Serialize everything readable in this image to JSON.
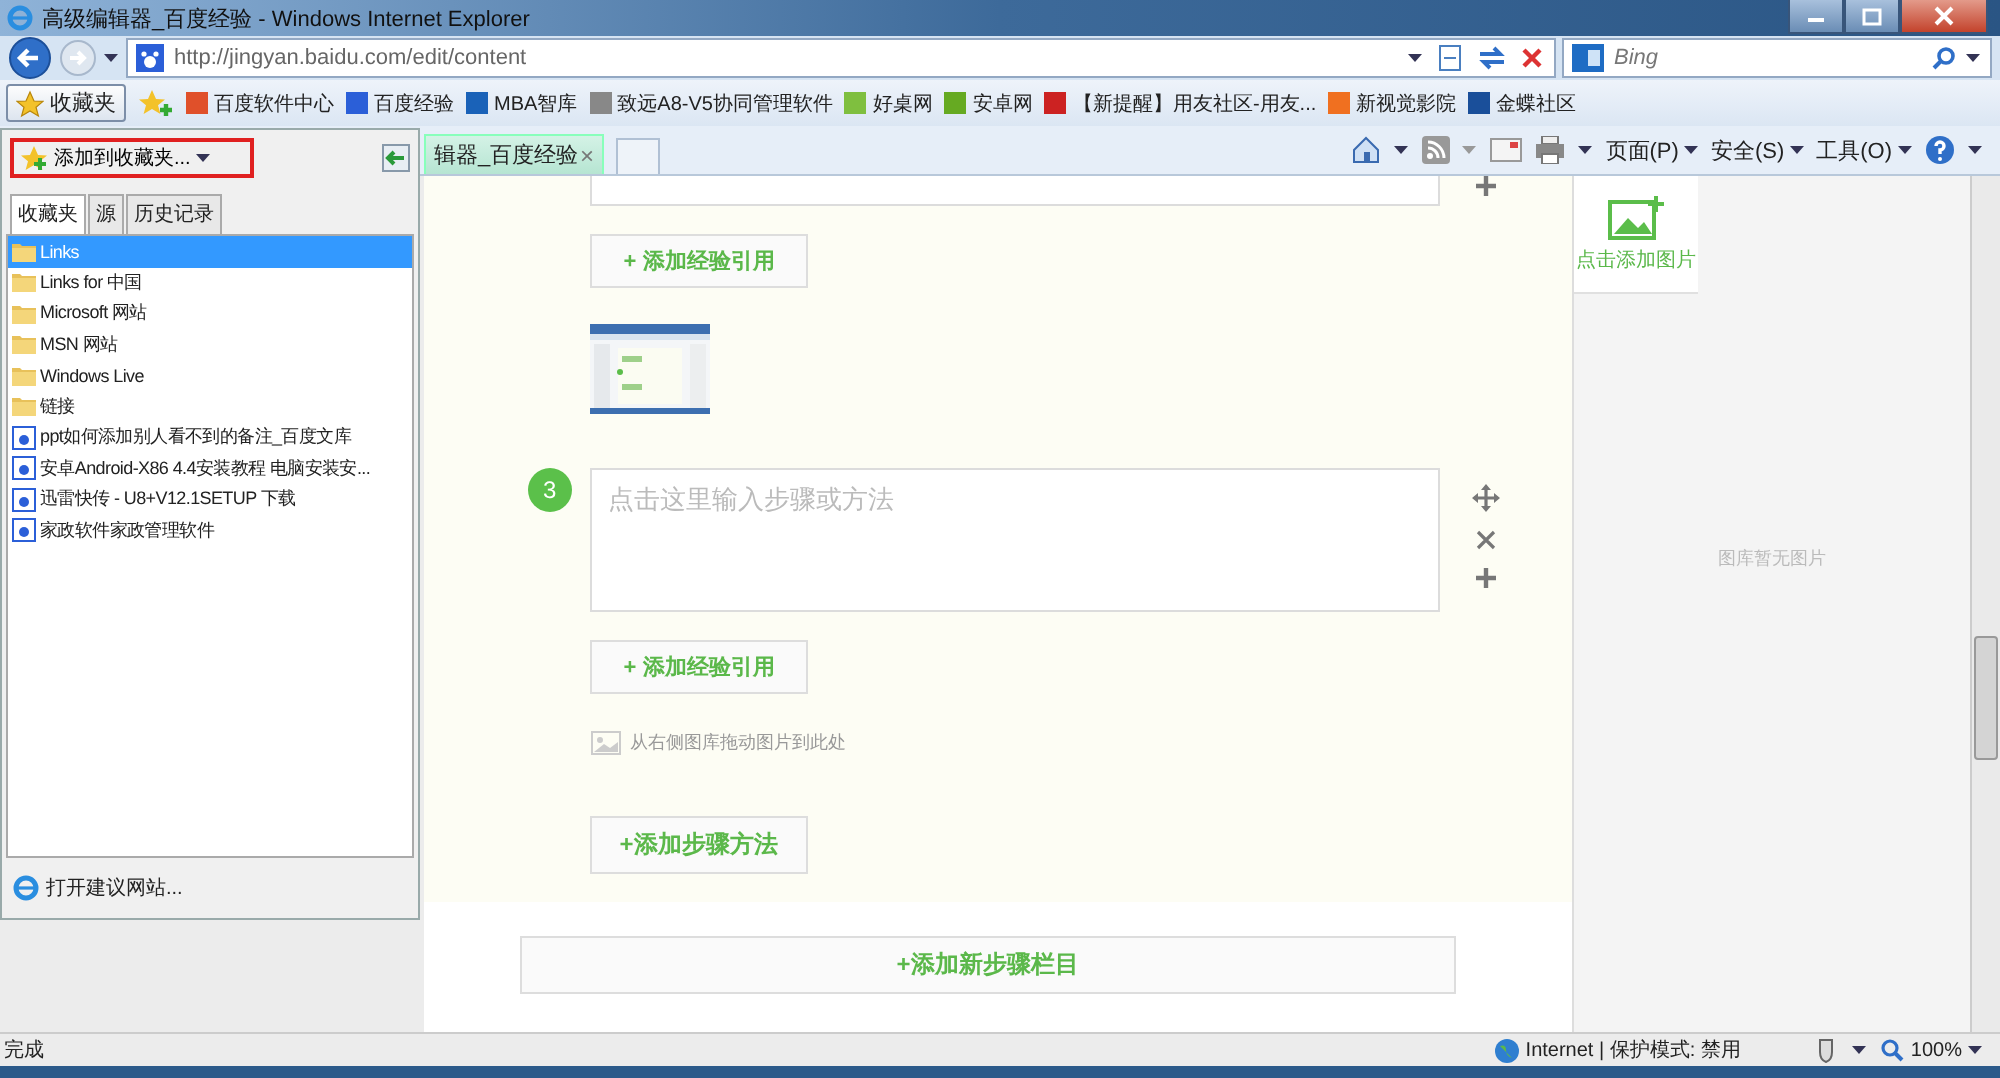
{
  "window": {
    "title": "高级编辑器_百度经验 - Windows Internet Explorer"
  },
  "address_bar": {
    "url": "http://jingyan.baidu.com/edit/content",
    "search_placeholder": "Bing"
  },
  "favorites_bar": {
    "button": "收藏夹",
    "items": [
      {
        "label": "百度软件中心",
        "color": "#e0502a"
      },
      {
        "label": "百度经验",
        "color": "#2b5fd8"
      },
      {
        "label": "MBA智库",
        "color": "#1a62b8"
      },
      {
        "label": "致远A8-V5协同管理软件",
        "color": "#888888"
      },
      {
        "label": "好桌网",
        "color": "#7fbf3f"
      },
      {
        "label": "安卓网",
        "color": "#66aa22"
      },
      {
        "label": "【新提醒】用友社区-用友...",
        "color": "#cc2222"
      },
      {
        "label": "新视觉影院",
        "color": "#f07020"
      },
      {
        "label": "金蝶社区",
        "color": "#1a4f9a"
      }
    ]
  },
  "tab": {
    "title": "辑器_百度经验",
    "close": "×"
  },
  "command_bar": {
    "menus": [
      "页面(P)",
      "安全(S)",
      "工具(O)"
    ]
  },
  "favorites_panel": {
    "add_button": "添加到收藏夹...",
    "tabs": [
      {
        "label": "收藏夹",
        "selected": true
      },
      {
        "label": "源",
        "selected": false
      },
      {
        "label": "历史记录",
        "selected": false
      }
    ],
    "items": [
      {
        "label": "Links",
        "kind": "folder",
        "selected": true
      },
      {
        "label": "Links for 中国",
        "kind": "folder",
        "selected": false
      },
      {
        "label": "Microsoft 网站",
        "kind": "folder",
        "selected": false
      },
      {
        "label": "MSN 网站",
        "kind": "folder",
        "selected": false
      },
      {
        "label": "Windows Live",
        "kind": "folder",
        "selected": false
      },
      {
        "label": "链接",
        "kind": "folder",
        "selected": false
      },
      {
        "label": "ppt如何添加别人看不到的备注_百度文库",
        "kind": "page",
        "selected": false
      },
      {
        "label": "安卓Android-X86 4.4安装教程 电脑安装安...",
        "kind": "page",
        "selected": false
      },
      {
        "label": "迅雷快传 - U8+V12.1SETUP 下载",
        "kind": "page",
        "selected": false
      },
      {
        "label": "家政软件家政管理软件",
        "kind": "page",
        "selected": false
      }
    ],
    "footer_link": "打开建议网站..."
  },
  "editor": {
    "reference_button": "+ 添加经验引用",
    "steps": [
      {
        "number": "3",
        "placeholder": "点击这里输入步骤或方法",
        "reference_button": "+ 添加经验引用",
        "drop_hint": "从右侧图库拖动图片到此处"
      }
    ],
    "add_step_button": "+添加步骤方法",
    "add_section_button": "+添加新步骤栏目"
  },
  "image_library": {
    "add_image": "点击添加图片",
    "empty_text": "图库暂无图片"
  },
  "status_bar": {
    "status": "完成",
    "zone": "Internet | 保护模式: 禁用",
    "zoom": "100%"
  }
}
